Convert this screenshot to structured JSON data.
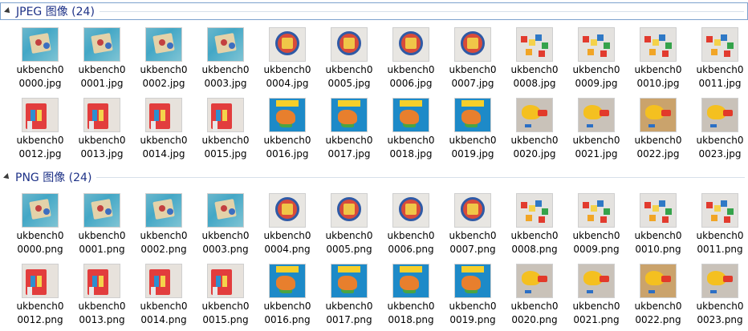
{
  "groups": [
    {
      "title": "JPEG 图像 (24)",
      "items": [
        {
          "line1": "ukbench0",
          "line2": "0000.jpg",
          "thumb": "puzzle"
        },
        {
          "line1": "ukbench0",
          "line2": "0001.jpg",
          "thumb": "puzzle"
        },
        {
          "line1": "ukbench0",
          "line2": "0002.jpg",
          "thumb": "puzzle"
        },
        {
          "line1": "ukbench0",
          "line2": "0003.jpg",
          "thumb": "puzzle"
        },
        {
          "line1": "ukbench0",
          "line2": "0004.jpg",
          "thumb": "round"
        },
        {
          "line1": "ukbench0",
          "line2": "0005.jpg",
          "thumb": "round"
        },
        {
          "line1": "ukbench0",
          "line2": "0006.jpg",
          "thumb": "round"
        },
        {
          "line1": "ukbench0",
          "line2": "0007.jpg",
          "thumb": "round"
        },
        {
          "line1": "ukbench0",
          "line2": "0008.jpg",
          "thumb": "blocks"
        },
        {
          "line1": "ukbench0",
          "line2": "0009.jpg",
          "thumb": "blocks"
        },
        {
          "line1": "ukbench0",
          "line2": "0010.jpg",
          "thumb": "blocks"
        },
        {
          "line1": "ukbench0",
          "line2": "0011.jpg",
          "thumb": "blocks"
        },
        {
          "line1": "ukbench0",
          "line2": "0012.jpg",
          "thumb": "box"
        },
        {
          "line1": "ukbench0",
          "line2": "0013.jpg",
          "thumb": "box"
        },
        {
          "line1": "ukbench0",
          "line2": "0014.jpg",
          "thumb": "box"
        },
        {
          "line1": "ukbench0",
          "line2": "0015.jpg",
          "thumb": "box"
        },
        {
          "line1": "ukbench0",
          "line2": "0016.jpg",
          "thumb": "book"
        },
        {
          "line1": "ukbench0",
          "line2": "0017.jpg",
          "thumb": "book"
        },
        {
          "line1": "ukbench0",
          "line2": "0018.jpg",
          "thumb": "book"
        },
        {
          "line1": "ukbench0",
          "line2": "0019.jpg",
          "thumb": "book"
        },
        {
          "line1": "ukbench0",
          "line2": "0020.jpg",
          "thumb": "duck"
        },
        {
          "line1": "ukbench0",
          "line2": "0021.jpg",
          "thumb": "duck"
        },
        {
          "line1": "ukbench0",
          "line2": "0022.jpg",
          "thumb": "duck-warm"
        },
        {
          "line1": "ukbench0",
          "line2": "0023.jpg",
          "thumb": "duck"
        }
      ]
    },
    {
      "title": "PNG 图像 (24)",
      "items": [
        {
          "line1": "ukbench0",
          "line2": "0000.png",
          "thumb": "puzzle"
        },
        {
          "line1": "ukbench0",
          "line2": "0001.png",
          "thumb": "puzzle"
        },
        {
          "line1": "ukbench0",
          "line2": "0002.png",
          "thumb": "puzzle"
        },
        {
          "line1": "ukbench0",
          "line2": "0003.png",
          "thumb": "puzzle"
        },
        {
          "line1": "ukbench0",
          "line2": "0004.png",
          "thumb": "round"
        },
        {
          "line1": "ukbench0",
          "line2": "0005.png",
          "thumb": "round"
        },
        {
          "line1": "ukbench0",
          "line2": "0006.png",
          "thumb": "round"
        },
        {
          "line1": "ukbench0",
          "line2": "0007.png",
          "thumb": "round"
        },
        {
          "line1": "ukbench0",
          "line2": "0008.png",
          "thumb": "blocks"
        },
        {
          "line1": "ukbench0",
          "line2": "0009.png",
          "thumb": "blocks"
        },
        {
          "line1": "ukbench0",
          "line2": "0010.png",
          "thumb": "blocks"
        },
        {
          "line1": "ukbench0",
          "line2": "0011.png",
          "thumb": "blocks"
        },
        {
          "line1": "ukbench0",
          "line2": "0012.png",
          "thumb": "box"
        },
        {
          "line1": "ukbench0",
          "line2": "0013.png",
          "thumb": "box"
        },
        {
          "line1": "ukbench0",
          "line2": "0014.png",
          "thumb": "box"
        },
        {
          "line1": "ukbench0",
          "line2": "0015.png",
          "thumb": "box"
        },
        {
          "line1": "ukbench0",
          "line2": "0016.png",
          "thumb": "book"
        },
        {
          "line1": "ukbench0",
          "line2": "0017.png",
          "thumb": "book"
        },
        {
          "line1": "ukbench0",
          "line2": "0018.png",
          "thumb": "book"
        },
        {
          "line1": "ukbench0",
          "line2": "0019.png",
          "thumb": "book"
        },
        {
          "line1": "ukbench0",
          "line2": "0020.png",
          "thumb": "duck"
        },
        {
          "line1": "ukbench0",
          "line2": "0021.png",
          "thumb": "duck"
        },
        {
          "line1": "ukbench0",
          "line2": "0022.png",
          "thumb": "duck-warm"
        },
        {
          "line1": "ukbench0",
          "line2": "0023.png",
          "thumb": "duck"
        }
      ]
    }
  ]
}
